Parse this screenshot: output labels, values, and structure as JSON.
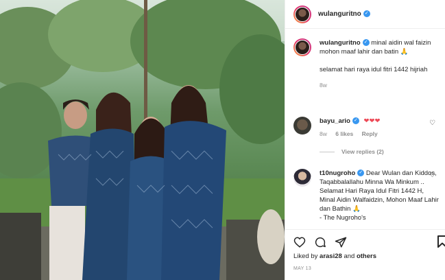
{
  "post": {
    "username": "wulanguritno",
    "verified_glyph": "✓"
  },
  "caption": {
    "username": "wulanguritno",
    "line1": "minal aidin wal faizin",
    "line2": "mohon maaf lahir dan batin",
    "line2_emoji": "🙏",
    "line3": "selamat hari raya idul fitri 1442 hijriah",
    "age": "8w"
  },
  "comments": [
    {
      "username": "bayu_ario",
      "text": "❤❤❤",
      "age": "8w",
      "likes": "6 likes",
      "reply": "Reply",
      "view_replies": "View replies (2)"
    },
    {
      "username": "t10nugroho",
      "text": "Dear Wulan dan Kiddos, Taqabbalallahu Minna Wa Minkum .. Selamat Hari Raya Idul Fitri 1442 H, Minal Aidin Walfaidzin, Mohon Maaf Lahir dan Bathin",
      "emoji": "🙏",
      "tail": "- The Nugroho's"
    }
  ],
  "footer": {
    "liked_prefix": "Liked by",
    "liked_user": "arasi28",
    "liked_suffix": "and",
    "liked_others": "others",
    "date": "MAY 13"
  },
  "icons": {
    "like": "heart-icon",
    "comment": "comment-icon",
    "share": "share-icon",
    "save": "bookmark-icon",
    "comment_like": "heart-outline-icon"
  },
  "colors": {
    "verified": "#3897f0",
    "heart_red": "#ed4956",
    "muted": "#8e8e8e",
    "text": "#262626"
  }
}
